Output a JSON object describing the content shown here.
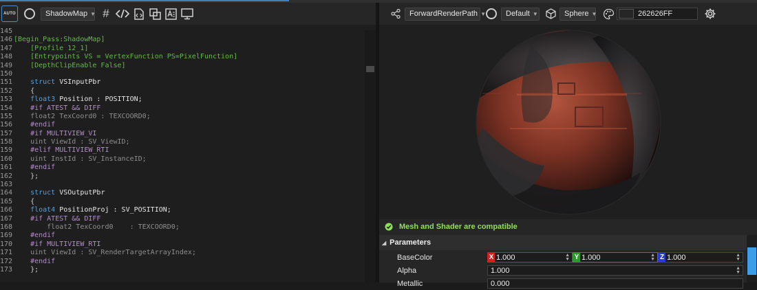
{
  "editor": {
    "pass_dropdown": "ShadowMap",
    "auto_label": "AUTO",
    "lines": [
      {
        "n": "145",
        "segs": []
      },
      {
        "n": "146",
        "segs": [
          {
            "t": "[Begin_Pass:ShadowMap]",
            "c": "#5fbf3f"
          }
        ]
      },
      {
        "n": "147",
        "segs": [
          {
            "t": "    [Profile 12_1]",
            "c": "#5fbf3f"
          }
        ]
      },
      {
        "n": "148",
        "segs": [
          {
            "t": "    [Entrypoints VS = VertexFunction PS=PixelFunction]",
            "c": "#5fbf3f"
          }
        ]
      },
      {
        "n": "149",
        "segs": [
          {
            "t": "    [DepthClipEnable False]",
            "c": "#5fbf3f"
          }
        ]
      },
      {
        "n": "150",
        "segs": []
      },
      {
        "n": "151",
        "segs": [
          {
            "t": "    struct ",
            "c": "#5a9fd8"
          },
          {
            "t": "VSInputPbr",
            "c": "#e8e8e8"
          }
        ]
      },
      {
        "n": "152",
        "segs": [
          {
            "t": "    {",
            "c": "#cfcfcf"
          }
        ]
      },
      {
        "n": "153",
        "segs": [
          {
            "t": "    float3 ",
            "c": "#5a9fd8"
          },
          {
            "t": "Position : POSITION;",
            "c": "#e8e8e8"
          }
        ]
      },
      {
        "n": "154",
        "segs": [
          {
            "t": "    #if ATEST && DIFF",
            "c": "#b78ad0"
          }
        ]
      },
      {
        "n": "155",
        "segs": [
          {
            "t": "    float2 TexCoord0 : TEXCOORD0;",
            "c": "#8f8f8f"
          }
        ]
      },
      {
        "n": "156",
        "segs": [
          {
            "t": "    #endif",
            "c": "#b78ad0"
          }
        ]
      },
      {
        "n": "157",
        "segs": [
          {
            "t": "    #if MULTIVIEW_VI",
            "c": "#b78ad0"
          }
        ]
      },
      {
        "n": "158",
        "segs": [
          {
            "t": "    uint ViewId : SV_ViewID;",
            "c": "#8f8f8f"
          }
        ]
      },
      {
        "n": "159",
        "segs": [
          {
            "t": "    #elif MULTIVIEW_RTI",
            "c": "#b78ad0"
          }
        ]
      },
      {
        "n": "160",
        "segs": [
          {
            "t": "    uint InstId : SV_InstanceID;",
            "c": "#8f8f8f"
          }
        ]
      },
      {
        "n": "161",
        "segs": [
          {
            "t": "    #endif",
            "c": "#b78ad0"
          }
        ]
      },
      {
        "n": "162",
        "segs": [
          {
            "t": "    };",
            "c": "#cfcfcf"
          }
        ]
      },
      {
        "n": "163",
        "segs": []
      },
      {
        "n": "164",
        "segs": [
          {
            "t": "    struct ",
            "c": "#5a9fd8"
          },
          {
            "t": "VSOutputPbr",
            "c": "#e8e8e8"
          }
        ]
      },
      {
        "n": "165",
        "segs": [
          {
            "t": "    {",
            "c": "#cfcfcf"
          }
        ]
      },
      {
        "n": "166",
        "segs": [
          {
            "t": "    float4 ",
            "c": "#5a9fd8"
          },
          {
            "t": "PositionProj : SV_POSITION;",
            "c": "#e8e8e8"
          }
        ]
      },
      {
        "n": "167",
        "segs": [
          {
            "t": "    #if ATEST && DIFF",
            "c": "#b78ad0"
          }
        ]
      },
      {
        "n": "168",
        "segs": [
          {
            "t": "        float2 TexCoord0    : TEXCOORD0;",
            "c": "#8f8f8f"
          }
        ]
      },
      {
        "n": "169",
        "segs": [
          {
            "t": "    #endif",
            "c": "#b78ad0"
          }
        ]
      },
      {
        "n": "170",
        "segs": [
          {
            "t": "    #if MULTIVIEW_RTI",
            "c": "#b78ad0"
          }
        ]
      },
      {
        "n": "171",
        "segs": [
          {
            "t": "    uint ViewId : SV_RenderTargetArrayIndex;",
            "c": "#8f8f8f"
          }
        ]
      },
      {
        "n": "172",
        "segs": [
          {
            "t": "    #endif",
            "c": "#b78ad0"
          }
        ]
      },
      {
        "n": "173",
        "segs": [
          {
            "t": "    };",
            "c": "#cfcfcf"
          }
        ]
      }
    ]
  },
  "preview": {
    "render_path": "ForwardRenderPath",
    "material": "Default",
    "mesh": "Sphere",
    "background_color": "262626FF",
    "status": "Mesh and Shader are compatible",
    "status_color": "#8fe05a"
  },
  "parameters": {
    "header": "Parameters",
    "base_color": {
      "label": "BaseColor",
      "x_axis": "X",
      "x": "1.000",
      "y_axis": "Y",
      "y": "1.000",
      "z_axis": "Z",
      "z": "1.000"
    },
    "alpha": {
      "label": "Alpha",
      "value": "1.000"
    },
    "metallic": {
      "label": "Metallic",
      "value": "0.000"
    }
  },
  "colors": {
    "accent": "#3b82c4",
    "x_axis": "#d42020",
    "y_axis": "#2a9a2a",
    "z_axis": "#2a3ad8",
    "scroll_thumb": "#3a9ee8"
  }
}
